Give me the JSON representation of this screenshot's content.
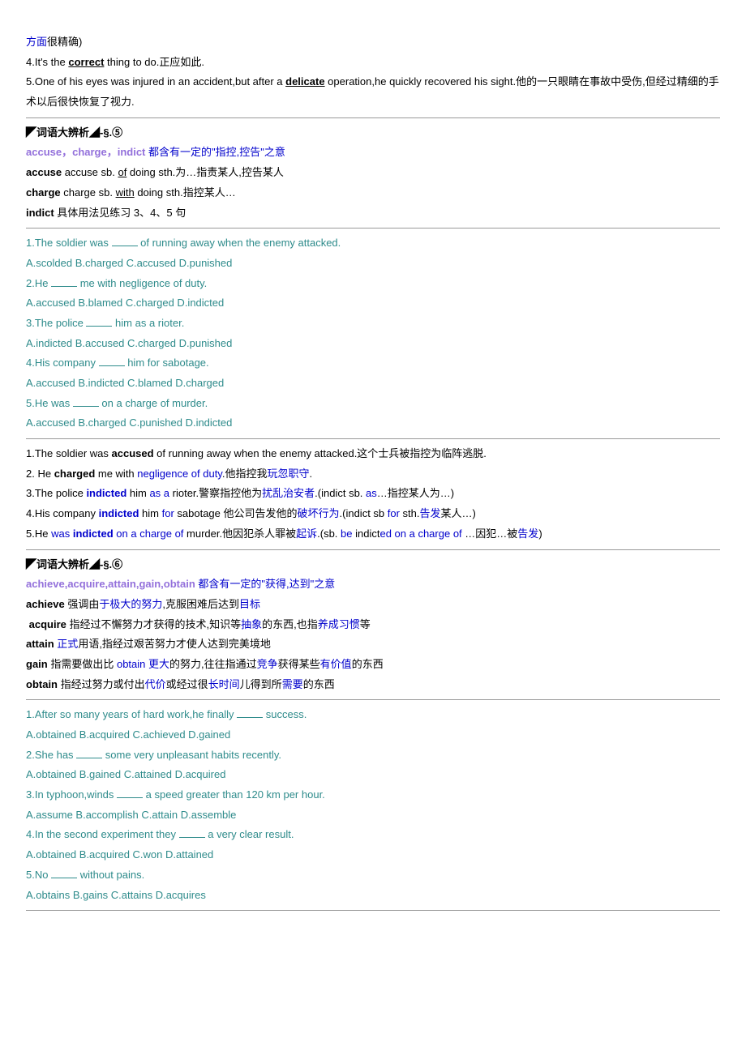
{
  "intro": {
    "line1a": "方面",
    "line1b": "很精确)",
    "line2a": "4.It's the ",
    "line2b": "correct",
    "line2c": " thing to do.正应如此.",
    "line3a": "5.One of his eyes was injured in an accident,but after a ",
    "line3b": "delicate",
    "line3c": " operation,he quickly recovered his sight.他的一只眼睛在事故中受伤,但经过精细的手术以后很快恢复了视力."
  },
  "s5": {
    "heading": "◤词语大辨析◢-§.⑤",
    "def_title_words": "accuse，charge，indict",
    "def_title_rest": " 都含有一定的\"指控,控告\"之意",
    "d1a": "accuse",
    "d1b": " accuse sb. ",
    "d1c": "of",
    "d1d": " doing sth.为…指责某人,控告某人",
    "d2a": "charge",
    "d2b": " charge sb. ",
    "d2c": "with",
    "d2d": " doing sth.指控某人…",
    "d3a": "indict",
    "d3b": " 具体用法见练习 3、4、5 句",
    "q1a": "1.The soldier was ",
    "q1b": " of running away when the enemy attacked.",
    "q1c": "A.scolded B.charged C.accused D.punished",
    "q2a": "2.He ",
    "q2b": " me with negligence of duty.",
    "q2c": "A.accused B.blamed C.charged D.indicted",
    "q3a": "3.The police ",
    "q3b": " him as a rioter.",
    "q3c": "A.indicted B.accused C.charged D.punished",
    "q4a": "4.His company ",
    "q4b": " him for sabotage.",
    "q4c": "A.accused B.indicted C.blamed D.charged",
    "q5a": "5.He was ",
    "q5b": " on a charge of murder.",
    "q5c": "A.accused B.charged C.punished D.indicted",
    "a1a": "1.The soldier was ",
    "a1b": "accused",
    "a1c": " of running away when the enemy attacked.这个士兵被指控为临阵逃脱.",
    "a2a": "2. He ",
    "a2b": "charged",
    "a2c": " me with ",
    "a2d": "negligence of duty",
    "a2e": ".他指控我",
    "a2f": "玩忽职守",
    "a2g": ".",
    "a3a": "3.The police ",
    "a3b": "indicted",
    "a3c": " him ",
    "a3d": "as a",
    "a3e": " rioter.警察指控他为",
    "a3f": "扰乱治安者",
    "a3g": ".(indict sb. ",
    "a3h": "as",
    "a3i": "…指控某人为…)",
    "a4a": "4.His company ",
    "a4b": "indicted",
    "a4c": " him ",
    "a4d": "for",
    "a4e": " sabotage 他公司告发他的",
    "a4f": "破坏行为",
    "a4g": ".(indict sb ",
    "a4h": "for",
    "a4i": " sth.",
    "a4j": "告发",
    "a4k": "某人…)",
    "a5a": "5.He ",
    "a5b": "was",
    "a5c": " ",
    "a5d": "indicted",
    "a5e": " ",
    "a5f": "on a charge of",
    "a5g": " murder.他因犯杀人罪被",
    "a5h": "起诉",
    "a5i": ".(sb. ",
    "a5j": "be",
    "a5k": " indict",
    "a5l": "ed on a charge of",
    "a5m": " …因犯…被",
    "a5n": "告发",
    "a5o": ")"
  },
  "s6": {
    "heading": "◤词语大辨析◢-§.⑥",
    "def_title_words": "achieve,acquire,attain,gain,obtain",
    "def_title_rest": " 都含有一定的\"获得,达到\"之意",
    "d1a": "achieve",
    "d1b": " 强调由",
    "d1c": "于极大的努力",
    "d1d": ",克服困难后达到",
    "d1e": "目标",
    "d2a": "acquire",
    "d2b": " 指经过不懈努力才获得的技术,知识等",
    "d2c": "抽象",
    "d2d": "的东西,也指",
    "d2e": "养成习惯",
    "d2f": "等",
    "d3a": "attain",
    "d3b": " ",
    "d3c": "正式",
    "d3d": "用语,指经过艰苦努力才使人达到完美境地",
    "d4a": "gain",
    "d4b": " 指需要做出比 ",
    "d4c": "obtain 更大",
    "d4d": "的努力,往往指通过",
    "d4e": "竞争",
    "d4f": "获得某些",
    "d4g": "有价值",
    "d4h": "的东西",
    "d5a": "obtain",
    "d5b": " 指经过努力或付出",
    "d5c": "代价",
    "d5d": "或经过很",
    "d5e": "长时间",
    "d5f": "儿得到所",
    "d5g": "需要",
    "d5h": "的东西",
    "q1a": "1.After so many years of hard work,he finally ",
    "q1b": " success.",
    "q1c": "A.obtained B.acquired C.achieved D.gained",
    "q2a": "2.She has ",
    "q2b": " some very unpleasant habits recently.",
    "q2c": "A.obtained B.gained C.attained D.acquired",
    "q3a": "3.In typhoon,winds ",
    "q3b": " a speed greater than 120 km per hour.",
    "q3c": "A.assume B.accomplish C.attain D.assemble",
    "q4a": "4.In the second experiment they ",
    "q4b": " a very clear result.",
    "q4c": "A.obtained B.acquired C.won D.attained",
    "q5a": "5.No ",
    "q5b": " without pains.",
    "q5c": "A.obtains B.gains C.attains D.acquires"
  }
}
